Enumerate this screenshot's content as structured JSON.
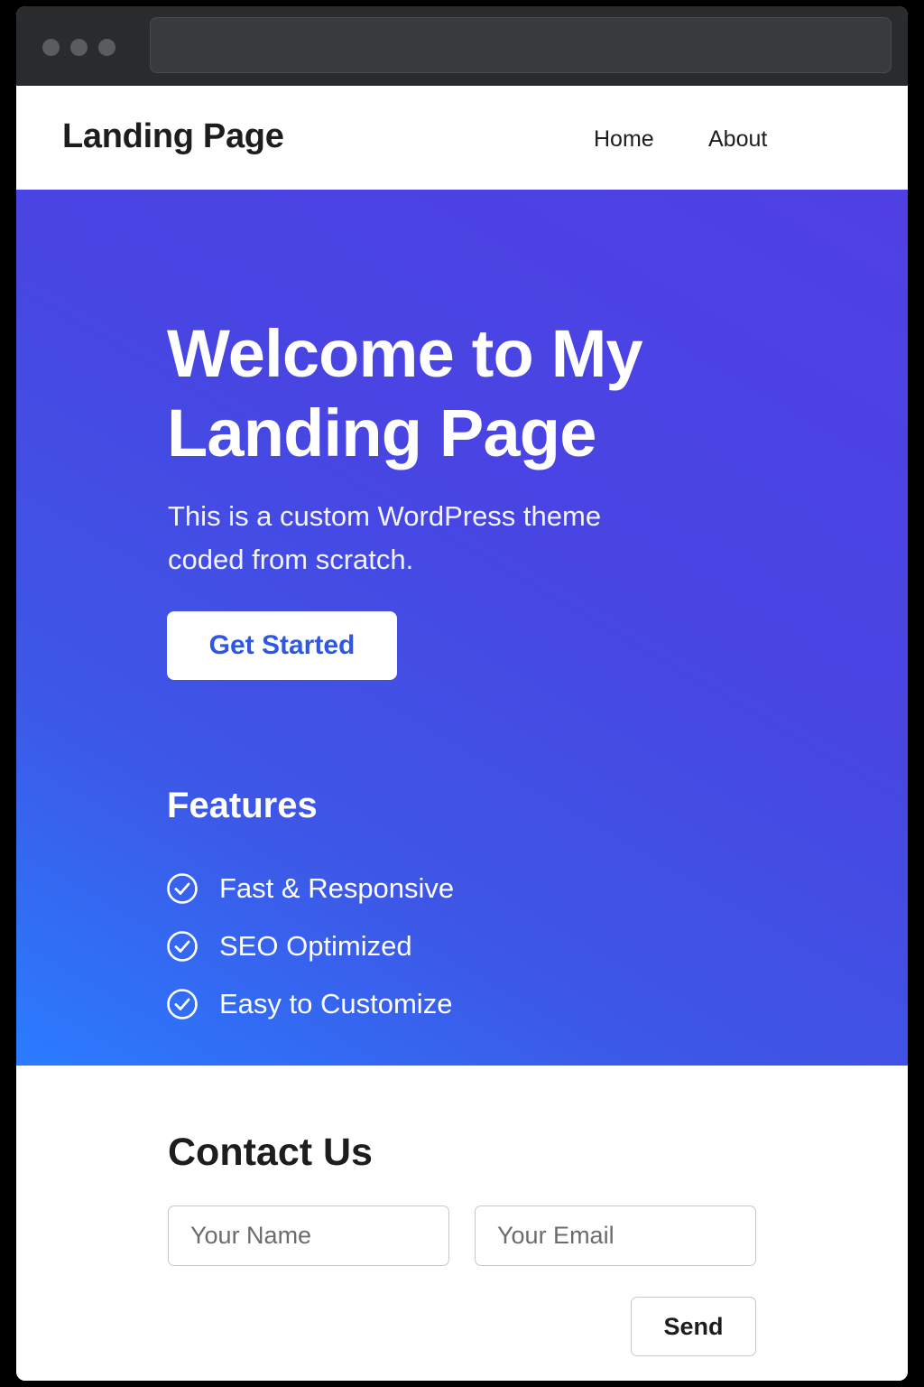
{
  "header": {
    "brand": "Landing Page",
    "nav": [
      {
        "label": "Home"
      },
      {
        "label": "About"
      }
    ]
  },
  "hero": {
    "title": "Welcome to My Landing Page",
    "subtitle": "This is a custom WordPress theme coded from scratch.",
    "cta_label": "Get Started",
    "gradient_colors": [
      "#2a7cff",
      "#5040e4"
    ]
  },
  "features": {
    "title": "Features",
    "items": [
      {
        "label": "Fast & Responsive",
        "icon": "check-circle-icon"
      },
      {
        "label": "SEO Optimized",
        "icon": "check-circle-icon"
      },
      {
        "label": "Easy to Customize",
        "icon": "check-circle-icon"
      }
    ]
  },
  "contact": {
    "title": "Contact Us",
    "name_placeholder": "Your Name",
    "email_placeholder": "Your Email",
    "send_label": "Send"
  }
}
